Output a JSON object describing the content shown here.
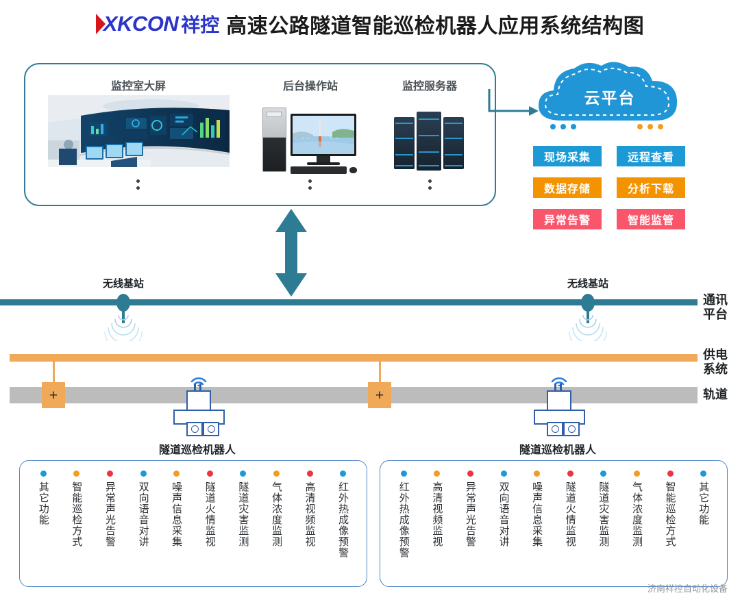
{
  "header": {
    "logo_mark": "red-arrow",
    "logo_text": "XKCON",
    "logo_text_cn": "祥控",
    "title": "高速公路隧道智能巡检机器人应用系统结构图"
  },
  "top_box": {
    "items": [
      {
        "label": "监控室大屏",
        "icon": "control-room-video-wall"
      },
      {
        "label": "后台操作站",
        "icon": "desktop-workstation"
      },
      {
        "label": "监控服务器",
        "icon": "server-rack"
      }
    ]
  },
  "cloud": {
    "label": "云平台",
    "color": "#2196d6",
    "dots_left": [
      "#2196d6",
      "#2196d6",
      "#2196d6"
    ],
    "dots_right": [
      "#f59b21",
      "#f59b21",
      "#f59b21"
    ]
  },
  "tags": [
    {
      "label": "现场采集",
      "color": "#1b9ad6"
    },
    {
      "label": "远程查看",
      "color": "#1b9ad6"
    },
    {
      "label": "数据存储",
      "color": "#f49300"
    },
    {
      "label": "分析下载",
      "color": "#f49300"
    },
    {
      "label": "异常告警",
      "color": "#f9566b"
    },
    {
      "label": "智能监管",
      "color": "#f9566b"
    }
  ],
  "rails": {
    "comm": {
      "label_line1": "通讯",
      "label_line2": "平台",
      "color": "#2e7b94"
    },
    "power": {
      "label_line1": "供电",
      "label_line2": "系统",
      "color": "#f0a958"
    },
    "track": {
      "label_line1": "轨道",
      "color": "#bcbcbc"
    }
  },
  "base_stations": [
    {
      "label": "无线基站"
    },
    {
      "label": "无线基站"
    }
  ],
  "junction_boxes": [
    {
      "symbol": "+"
    },
    {
      "symbol": "+"
    }
  ],
  "robots": [
    {
      "label": "隧道巡检机器人",
      "wifi": "wifi-icon"
    },
    {
      "label": "隧道巡检机器人",
      "wifi": "wifi-icon"
    }
  ],
  "feature_boxes": [
    {
      "title": "隧道巡检机器人",
      "items": [
        {
          "text": "其它功能",
          "color": "#1b9ad6"
        },
        {
          "text": "智能巡检方式",
          "color": "#f59b21"
        },
        {
          "text": "异常声光告警",
          "color": "#ef3340"
        },
        {
          "text": "双向语音对讲",
          "color": "#1b9ad6"
        },
        {
          "text": "噪声信息采集",
          "color": "#f59b21"
        },
        {
          "text": "隧道火情监视",
          "color": "#ef3340"
        },
        {
          "text": "隧道灾害监测",
          "color": "#1b9ad6"
        },
        {
          "text": "气体浓度监测",
          "color": "#f59b21"
        },
        {
          "text": "高清视频监视",
          "color": "#ef3340"
        },
        {
          "text": "红外热成像预警",
          "color": "#1b9ad6"
        }
      ]
    },
    {
      "title": "隧道巡检机器人",
      "items": [
        {
          "text": "红外热成像预警",
          "color": "#1b9ad6"
        },
        {
          "text": "高清视频监视",
          "color": "#f59b21"
        },
        {
          "text": "异常声光告警",
          "color": "#ef3340"
        },
        {
          "text": "双向语音对讲",
          "color": "#1b9ad6"
        },
        {
          "text": "噪声信息采集",
          "color": "#f59b21"
        },
        {
          "text": "隧道火情监视",
          "color": "#ef3340"
        },
        {
          "text": "隧道灾害监测",
          "color": "#1b9ad6"
        },
        {
          "text": "气体浓度监测",
          "color": "#f59b21"
        },
        {
          "text": "智能巡检方式",
          "color": "#ef3340"
        },
        {
          "text": "其它功能",
          "color": "#1b9ad6"
        }
      ]
    }
  ],
  "footer": {
    "text": "济南祥控自动化设备"
  }
}
